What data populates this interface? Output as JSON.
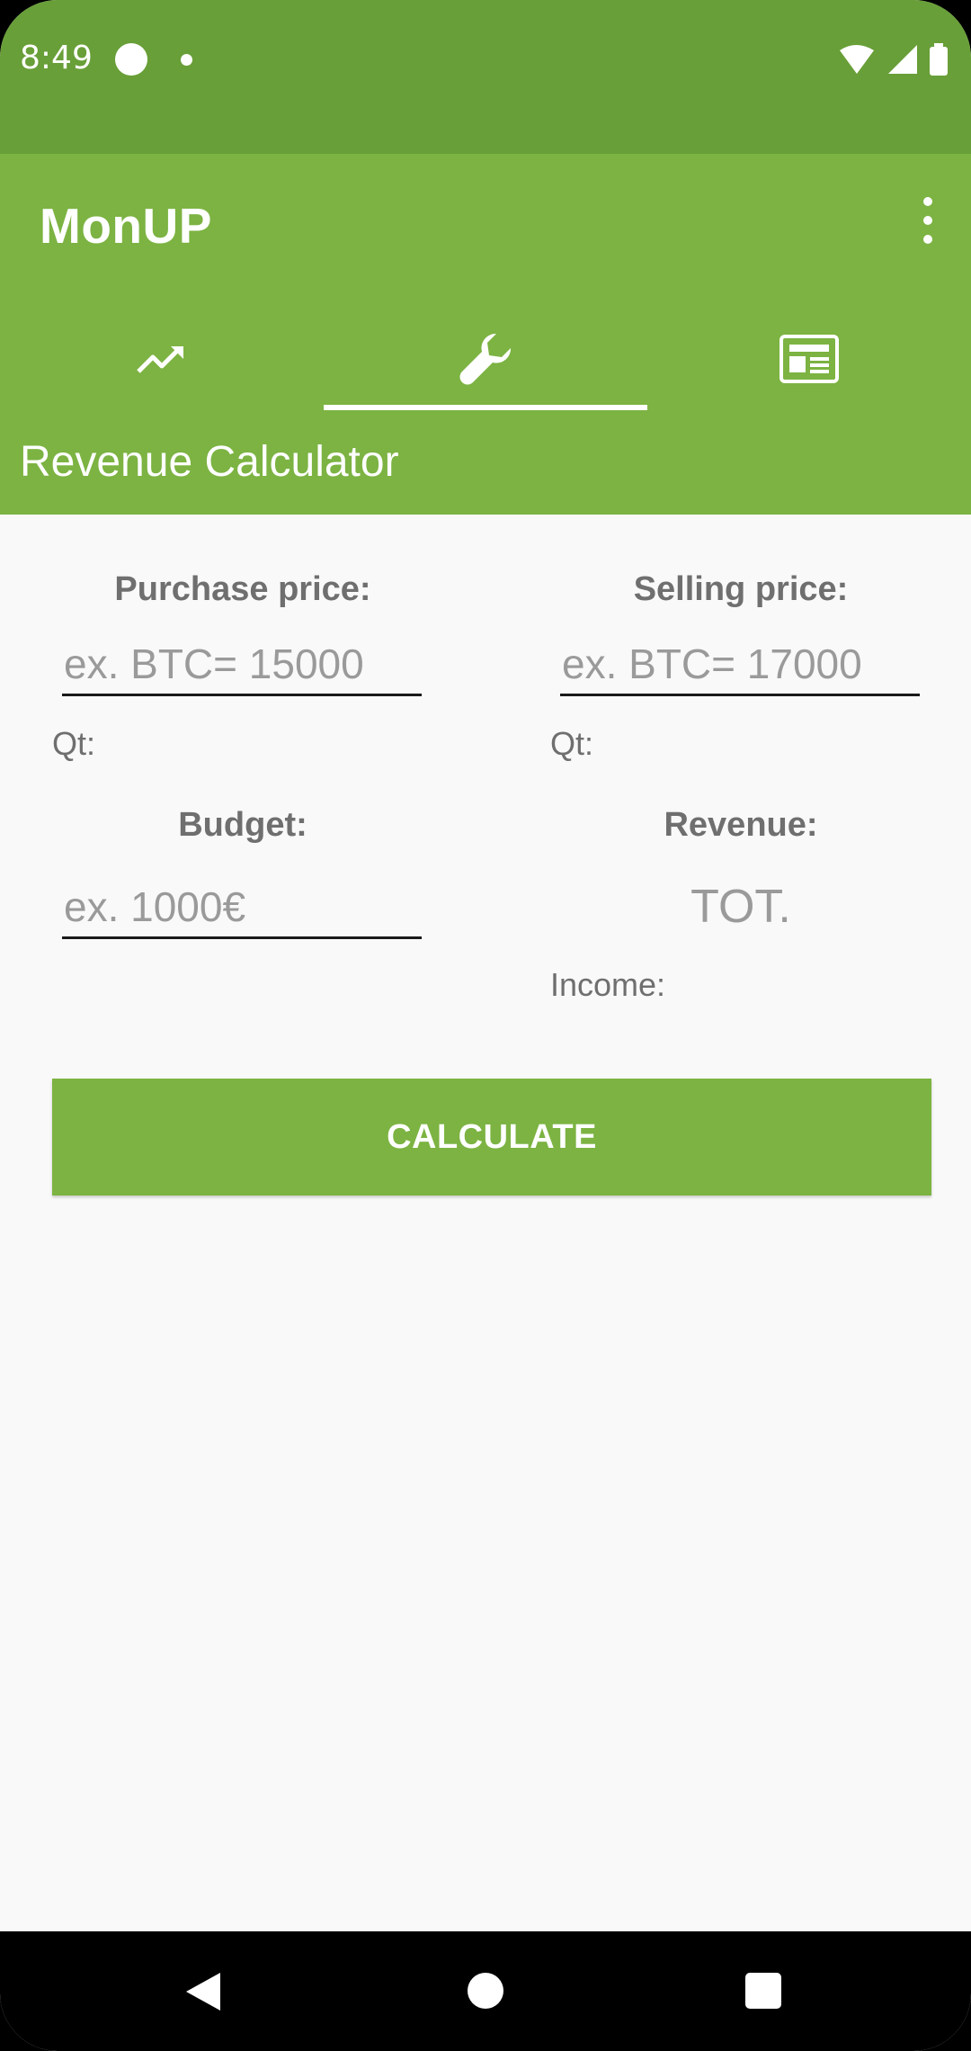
{
  "status_bar": {
    "time": "8:49",
    "icons": [
      "notification-circle-icon",
      "notification-dot-icon",
      "wifi-icon",
      "signal-icon",
      "battery-icon"
    ]
  },
  "app_bar": {
    "title": "MonUP",
    "background_color": "#7cb342",
    "status_bar_color": "#689f38"
  },
  "tabs": [
    {
      "icon": "trending-up-icon",
      "selected": false
    },
    {
      "icon": "wrench-icon",
      "selected": true
    },
    {
      "icon": "newspaper-icon",
      "selected": false
    }
  ],
  "section": {
    "title": "Revenue Calculator"
  },
  "form": {
    "purchase_price_label": "Purchase price:",
    "purchase_price_placeholder": "ex. BTC= 15000",
    "purchase_qt_label": "Qt:",
    "selling_price_label": "Selling price:",
    "selling_price_placeholder": "ex. BTC= 17000",
    "selling_qt_label": "Qt:",
    "budget_label": "Budget:",
    "budget_placeholder": "ex. 1000€",
    "revenue_label": "Revenue:",
    "revenue_total": "TOT.",
    "income_label": "Income:",
    "calculate_button": "CALCULATE"
  },
  "nav_bar": {
    "buttons": [
      "back-icon",
      "home-icon",
      "recents-icon"
    ]
  }
}
